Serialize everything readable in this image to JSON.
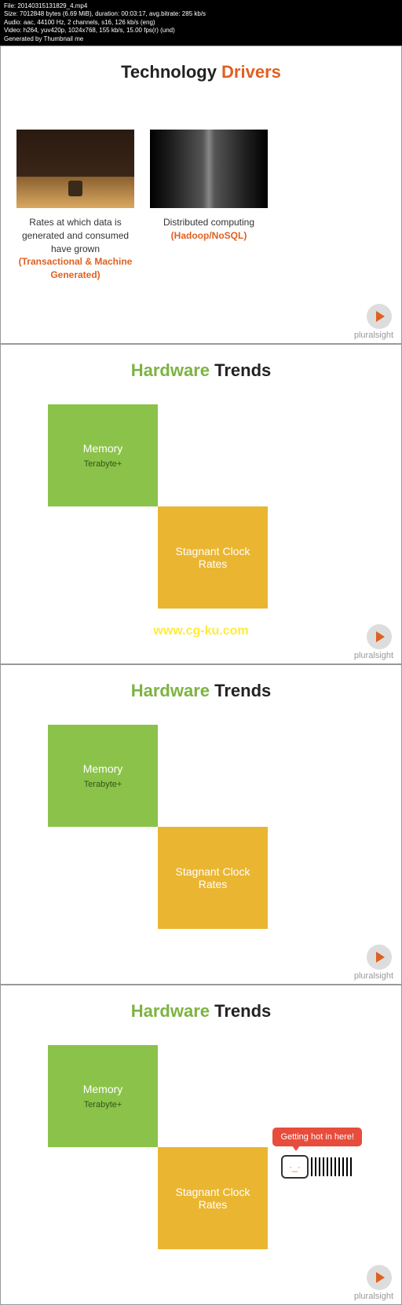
{
  "header": {
    "line1": "File: 20140315131829_4.mp4",
    "line2": "Size: 7012848 bytes (6.69 MiB), duration: 00:03:17, avg.bitrate: 285 kb/s",
    "line3": "Audio: aac, 44100 Hz, 2 channels, s16, 126 kb/s (eng)",
    "line4": "Video: h264, yuv420p, 1024x768, 155 kb/s, 15.00 fps(r) (und)",
    "line5": "Generated by Thumbnail me"
  },
  "slides": [
    {
      "title_pre": "Technology ",
      "title_accent": "Drivers",
      "columns": [
        {
          "caption": "Rates at which data is generated and consumed have grown",
          "highlight": "(Transactional & Machine Generated)"
        },
        {
          "caption": "Distributed computing",
          "highlight": "(Hadoop/NoSQL)"
        }
      ]
    },
    {
      "title_pre": "Hardware ",
      "title_accent_word": "Hardware",
      "title_rest": " Trends",
      "box1_title": "Memory",
      "box1_sub": "Terabyte+",
      "box2_title": "Stagnant Clock Rates",
      "watermark": "www.cg-ku.com"
    },
    {
      "title_accent_word": "Hardware",
      "title_rest": " Trends",
      "box1_title": "Memory",
      "box1_sub": "Terabyte+",
      "box2_title": "Stagnant Clock Rates"
    },
    {
      "title_accent_word": "Hardware",
      "title_rest": " Trends",
      "box1_title": "Memory",
      "box1_sub": "Terabyte+",
      "box2_title": "Stagnant Clock Rates",
      "speech": "Getting hot in here!"
    }
  ],
  "brand": "pluralsight"
}
